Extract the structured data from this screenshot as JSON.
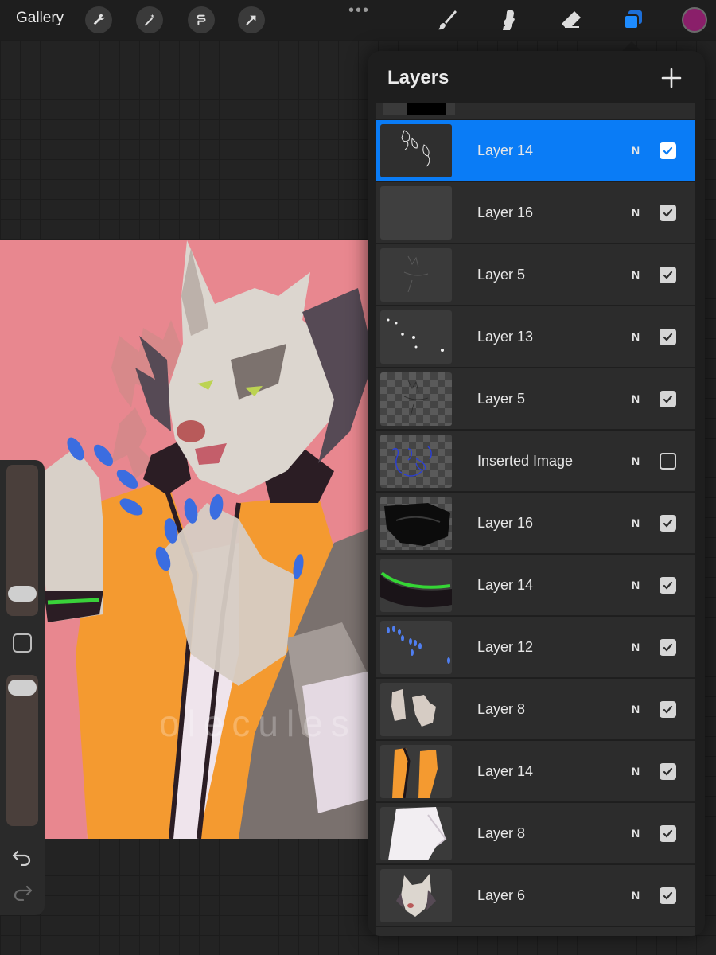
{
  "toolbar": {
    "gallery_label": "Gallery",
    "left_tools": [
      "wrench-icon",
      "magic-wand-icon",
      "selection-icon",
      "transform-arrow-icon"
    ],
    "more_dots": "•••",
    "right_tools": [
      "brush-icon",
      "smudge-icon",
      "eraser-icon",
      "layers-icon"
    ],
    "active_color": "#8a1f6a",
    "accent_color": "#0a7cf6"
  },
  "canvas": {
    "background_color": "#e8878f",
    "watermark": "olecules"
  },
  "layers_panel": {
    "title": "Layers",
    "add_label": "+",
    "layers": [
      {
        "name": "Layer 14",
        "blend": "N",
        "visible": true,
        "selected": true
      },
      {
        "name": "Layer 16",
        "blend": "N",
        "visible": true,
        "selected": false
      },
      {
        "name": "Layer 5",
        "blend": "N",
        "visible": true,
        "selected": false
      },
      {
        "name": "Layer 13",
        "blend": "N",
        "visible": true,
        "selected": false
      },
      {
        "name": "Layer 5",
        "blend": "N",
        "visible": true,
        "selected": false
      },
      {
        "name": "Inserted Image",
        "blend": "N",
        "visible": false,
        "selected": false
      },
      {
        "name": "Layer 16",
        "blend": "N",
        "visible": true,
        "selected": false
      },
      {
        "name": "Layer 14",
        "blend": "N",
        "visible": true,
        "selected": false
      },
      {
        "name": "Layer 12",
        "blend": "N",
        "visible": true,
        "selected": false
      },
      {
        "name": "Layer 8",
        "blend": "N",
        "visible": true,
        "selected": false
      },
      {
        "name": "Layer 14",
        "blend": "N",
        "visible": true,
        "selected": false
      },
      {
        "name": "Layer 8",
        "blend": "N",
        "visible": true,
        "selected": false
      },
      {
        "name": "Layer 6",
        "blend": "N",
        "visible": true,
        "selected": false
      }
    ]
  }
}
